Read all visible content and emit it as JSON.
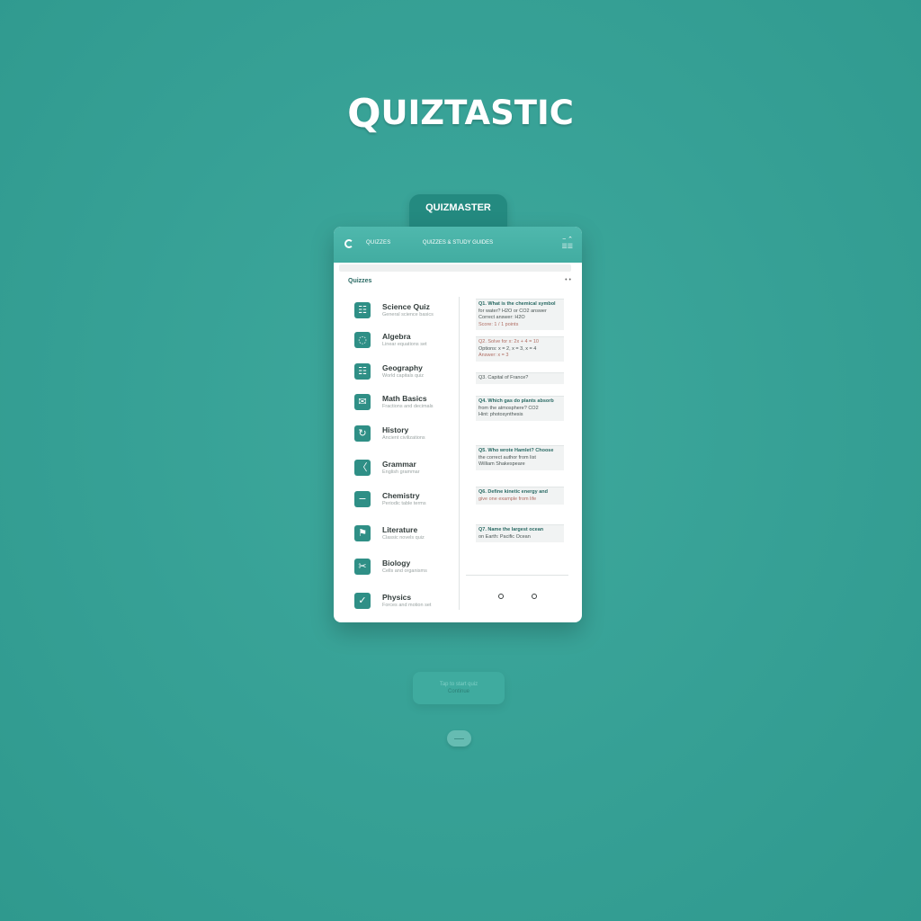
{
  "app": {
    "logo_lead": "Q",
    "logo_rest": "UIZTASTIC",
    "tab_label": "QUIZMASTER"
  },
  "header": {
    "left_label": "QUIZZES",
    "title": "QUIZZES & STUDY GUIDES",
    "right_top": "− ⌃",
    "right_bottom": "☰☰"
  },
  "section": {
    "label": "Quizzes",
    "menu_glyph": "• •"
  },
  "list": [
    {
      "icon": "quiz-book-icon",
      "glyph": "☷",
      "title": "Science Quiz",
      "subtitle": "General science basics"
    },
    {
      "icon": "bubble-icon",
      "glyph": "◌",
      "title": "Algebra",
      "subtitle": "Linear equations set"
    },
    {
      "icon": "grid-icon",
      "glyph": "☷",
      "title": "Geography",
      "subtitle": "World capitals quiz"
    },
    {
      "icon": "speech-icon",
      "glyph": "✉",
      "title": "Math Basics",
      "subtitle": "Fractions and decimals"
    },
    {
      "icon": "cycle-icon",
      "glyph": "↻",
      "title": "History",
      "subtitle": "Ancient civilizations"
    },
    {
      "icon": "bracket-icon",
      "glyph": "〈",
      "title": "Grammar",
      "subtitle": "English grammar"
    },
    {
      "icon": "dash-icon",
      "glyph": "−",
      "title": "Chemistry",
      "subtitle": "Periodic table terms"
    },
    {
      "icon": "flag-icon",
      "glyph": "⚑",
      "title": "Literature",
      "subtitle": "Classic novels quiz"
    },
    {
      "icon": "scissors-icon",
      "glyph": "✂",
      "title": "Biology",
      "subtitle": "Cells and organisms"
    },
    {
      "icon": "check-icon",
      "glyph": "✓",
      "title": "Physics",
      "subtitle": "Forces and motion set"
    }
  ],
  "questions": [
    {
      "lines": [
        {
          "text": "Q1. What is the chemical symbol",
          "tone": "hl"
        },
        {
          "text": "for water? H2O or CO2 answer",
          "tone": "normal"
        },
        {
          "text": "Correct answer: H2O",
          "tone": "normal"
        },
        {
          "text": "Score: 1 / 1 points",
          "tone": "alt"
        }
      ]
    },
    {
      "lines": [
        {
          "text": "Q2. Solve for x: 2x + 4 = 10",
          "tone": "alt"
        },
        {
          "text": "Options: x = 2, x = 3, x = 4",
          "tone": "normal"
        },
        {
          "text": "Answer: x = 3",
          "tone": "alt"
        }
      ]
    },
    {
      "lines": [
        {
          "text": "Q3. Capital of France?",
          "tone": "normal"
        }
      ]
    },
    {
      "lines": [
        {
          "text": "Q4. Which gas do plants absorb",
          "tone": "hl"
        },
        {
          "text": "from the atmosphere? CO2",
          "tone": "normal"
        },
        {
          "text": "Hint: photosynthesis",
          "tone": "normal"
        }
      ]
    },
    {
      "lines": [
        {
          "text": "Q5. Who wrote Hamlet? Choose",
          "tone": "hl"
        },
        {
          "text": "the correct author from list",
          "tone": "normal"
        },
        {
          "text": "William Shakespeare",
          "tone": "normal"
        }
      ]
    },
    {
      "lines": [
        {
          "text": "Q6. Define kinetic energy and",
          "tone": "hl"
        },
        {
          "text": "give one example from life",
          "tone": "alt"
        }
      ]
    },
    {
      "lines": [
        {
          "text": "Q7. Name the largest ocean",
          "tone": "hl"
        },
        {
          "text": "on Earth: Pacific Ocean",
          "tone": "normal"
        }
      ]
    }
  ],
  "footer": {
    "ghost_line1": "Tap to start quiz",
    "ghost_line2": "Continue"
  },
  "colors": {
    "background": "#36a095",
    "header": "#42aca1",
    "accent": "#2f8f86",
    "tab": "#248a80"
  }
}
